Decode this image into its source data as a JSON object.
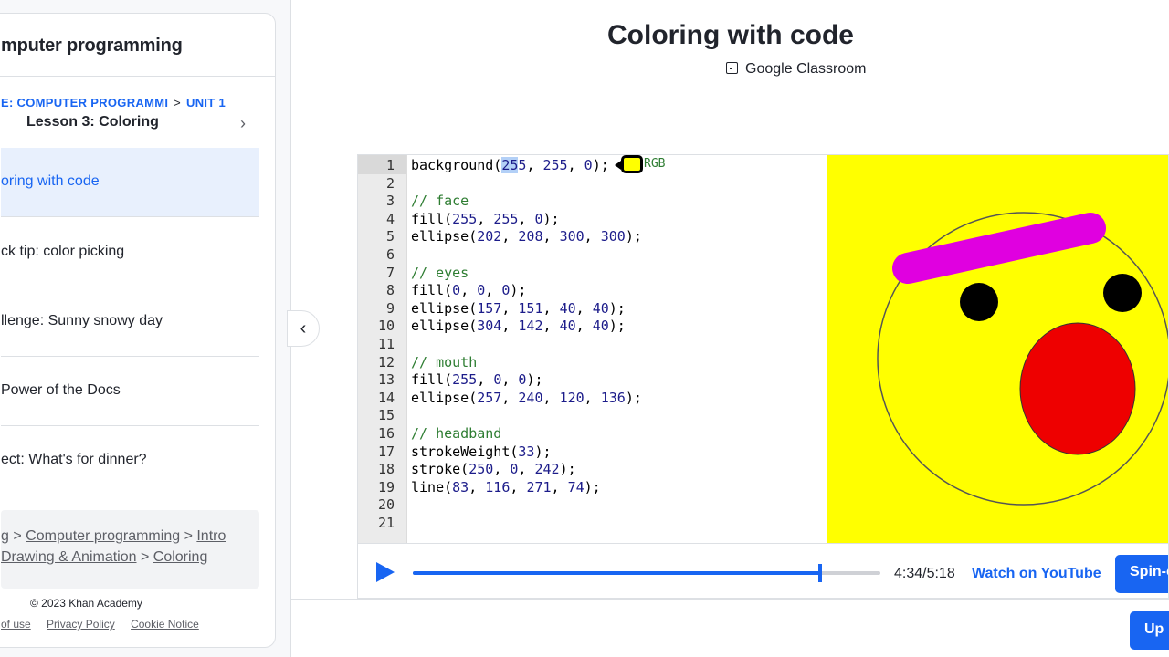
{
  "sidebar": {
    "course_title": "mputer programming",
    "breadcrumb_course": "E: COMPUTER PROGRAMMI",
    "breadcrumb_sep": ">",
    "breadcrumb_unit": "UNIT 1",
    "lesson_title": "Lesson 3: Coloring",
    "items": [
      {
        "label": "oring with code",
        "active": true
      },
      {
        "label": "ck tip: color picking",
        "active": false
      },
      {
        "label": "llenge: Sunny snowy day",
        "active": false
      },
      {
        "label": " Power of the Docs",
        "active": false
      },
      {
        "label": "ect: What's for dinner?",
        "active": false
      }
    ],
    "footer_crumbs": {
      "c0": "g",
      "c1": "Computer programming",
      "c2": "Intro",
      "c3": "Drawing & Animation",
      "c4": "Coloring",
      "sep": ">"
    },
    "copyright": "© 2023 Khan Academy",
    "legal": [
      "of use",
      "Privacy Policy",
      "Cookie Notice"
    ]
  },
  "header": {
    "title": "Coloring with code",
    "classroom": "Google Classroom"
  },
  "editor": {
    "line_numbers": [
      "1",
      "2",
      "3",
      "4",
      "5",
      "6",
      "7",
      "8",
      "9",
      "10",
      "11",
      "12",
      "13",
      "14",
      "15",
      "16",
      "17",
      "18",
      "19",
      "20",
      "21"
    ],
    "color_picker_label": "RGB",
    "colors": {
      "background": "#ffff00",
      "face": "#ffff00",
      "eyes": "#000000",
      "mouth": "#ff0000",
      "headband": "#fa00f2"
    }
  },
  "player": {
    "progress": 0.872,
    "time": "4:34/5:18",
    "watch_link": "Watch on YouTube",
    "spin_label": "Spin-o"
  },
  "up_label": "Up"
}
